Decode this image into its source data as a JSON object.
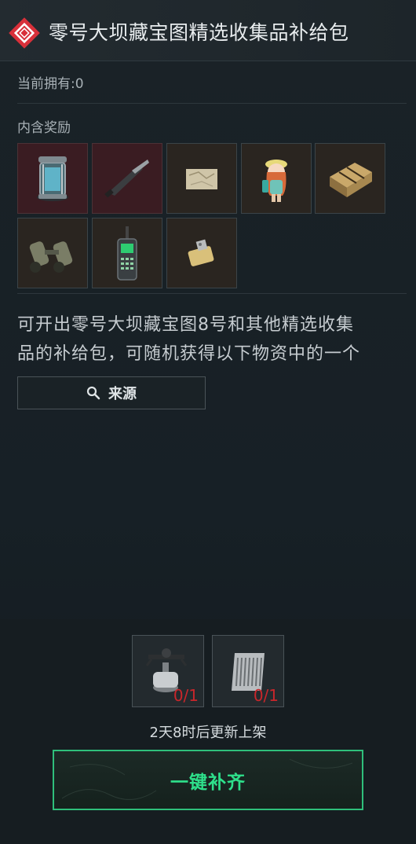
{
  "header": {
    "title": "零号大坝藏宝图精选收集品补给包",
    "icon": "red-diamond-icon"
  },
  "owned": {
    "label": "当前拥有:0"
  },
  "rewards": {
    "label": "内含奖励",
    "items": [
      {
        "name": "lantern-item",
        "rarity": "red"
      },
      {
        "name": "knife-item",
        "rarity": "red"
      },
      {
        "name": "map-item",
        "rarity": "gold"
      },
      {
        "name": "doll-figure-item",
        "rarity": "gold"
      },
      {
        "name": "crate-item",
        "rarity": "gold"
      },
      {
        "name": "binoculars-item",
        "rarity": "gold"
      },
      {
        "name": "radio-item",
        "rarity": "gold"
      },
      {
        "name": "lighter-item",
        "rarity": "gold"
      }
    ]
  },
  "description": {
    "line1": "可开出零号大坝藏宝图8号和其他精选收集",
    "line2": "品的补给包，可随机获得以下物资中的一个"
  },
  "source_button": {
    "label": "来源",
    "icon": "search-icon"
  },
  "cost": [
    {
      "name": "gas-stove-item",
      "count": "0/1"
    },
    {
      "name": "filter-box-item",
      "count": "0/1"
    }
  ],
  "restock": {
    "text": "2天8时后更新上架"
  },
  "fill_button": {
    "label": "一键补齐"
  },
  "colors": {
    "accent_green": "#2ee08b",
    "red_count": "#c8262b",
    "red_rarity": "#3a1c22",
    "gold_rarity": "#2a2520"
  }
}
